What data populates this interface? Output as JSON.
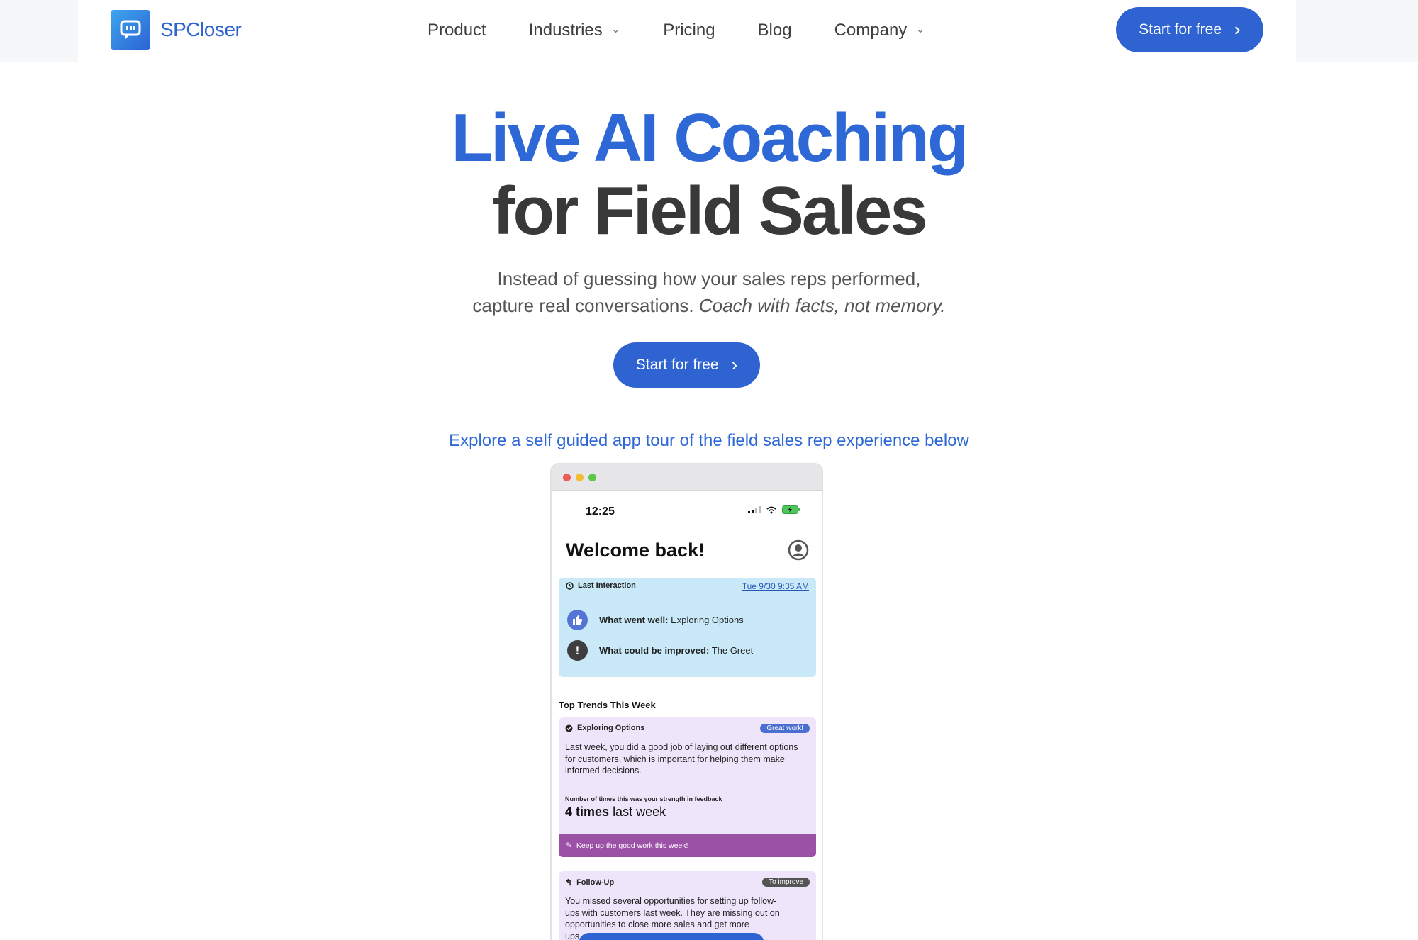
{
  "brand": {
    "name": "SPCloser",
    "color": "#2e63d1"
  },
  "nav": [
    {
      "label": "Product",
      "has_dropdown": false
    },
    {
      "label": "Industries",
      "has_dropdown": true
    },
    {
      "label": "Pricing",
      "has_dropdown": false
    },
    {
      "label": "Blog",
      "has_dropdown": false
    },
    {
      "label": "Company",
      "has_dropdown": true
    }
  ],
  "header_cta": {
    "label": "Start for free"
  },
  "hero": {
    "title_line1": "Live AI Coaching",
    "title_line2": "for Field Sales",
    "subtitle_line1": "Instead of guessing how your sales reps performed,",
    "subtitle_line2_plain": "capture real conversations.",
    "subtitle_line2_italic": "Coach with facts, not memory.",
    "cta_label": "Start for free"
  },
  "tour_link": "Explore a self guided app tour of the field sales rep experience below",
  "app": {
    "time": "12:25",
    "welcome": "Welcome back!",
    "last_interaction": {
      "label": "Last Interaction",
      "date": "Tue 9/30 9:35 AM",
      "went_well_label": "What went well:",
      "went_well_value": "Exploring Options",
      "improve_label": "What could be improved:",
      "improve_value": "The Greet"
    },
    "trends_title": "Top Trends This Week",
    "trend1": {
      "title": "Exploring Options",
      "badge": "Great work!",
      "body": "Last week, you did a good job of laying out different options for customers, which is important for helping them make informed decisions.",
      "stat_label": "Number of times this was your strength in feedback",
      "stat_number": "4 times",
      "stat_suffix": "last week",
      "footer": "Keep up the good work this week!"
    },
    "trend2": {
      "title": "Follow-Up",
      "badge": "To improve",
      "body_line1": "You missed several opportunities for setting up follow-",
      "body_line2": "ups with customers last week. They are missing out on",
      "body_line3": "opportunities to close more sales and get more",
      "body_line4": "ups"
    }
  },
  "colors": {
    "accent": "#2e63d1",
    "last_card_bg": "#c9e9f8",
    "trend_card_bg": "#eee5fb",
    "trend_footer_bg": "#9b51a6",
    "badge_great": "#4a6fd0",
    "badge_improve": "#555555"
  }
}
